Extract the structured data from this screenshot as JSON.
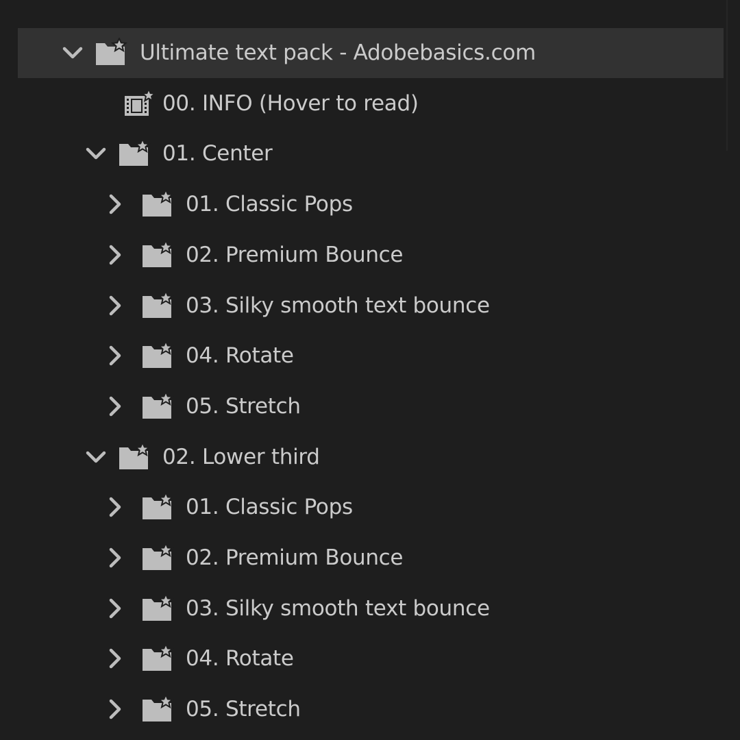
{
  "tree": [
    {
      "id": "root",
      "label": "Ultimate text pack - Adobebasics.com",
      "type": "bin",
      "depth": 0,
      "expanded": true,
      "selected": true
    },
    {
      "id": "info",
      "label": "00. INFO (Hover to read)",
      "type": "sequence",
      "depth": 1
    },
    {
      "id": "center",
      "label": "01. Center",
      "type": "bin",
      "depth": 1,
      "expanded": true
    },
    {
      "id": "center-classic-pops",
      "label": "01. Classic Pops",
      "type": "bin",
      "depth": 2,
      "expanded": false
    },
    {
      "id": "center-premium-bounce",
      "label": "02. Premium Bounce",
      "type": "bin",
      "depth": 2,
      "expanded": false
    },
    {
      "id": "center-silky-smooth",
      "label": "03. Silky smooth text bounce",
      "type": "bin",
      "depth": 2,
      "expanded": false
    },
    {
      "id": "center-rotate",
      "label": "04. Rotate",
      "type": "bin",
      "depth": 2,
      "expanded": false
    },
    {
      "id": "center-stretch",
      "label": "05. Stretch",
      "type": "bin",
      "depth": 2,
      "expanded": false
    },
    {
      "id": "lower-third",
      "label": "02. Lower third",
      "type": "bin",
      "depth": 1,
      "expanded": true
    },
    {
      "id": "lower-classic-pops",
      "label": "01. Classic Pops",
      "type": "bin",
      "depth": 2,
      "expanded": false
    },
    {
      "id": "lower-premium-bounce",
      "label": "02. Premium Bounce",
      "type": "bin",
      "depth": 2,
      "expanded": false
    },
    {
      "id": "lower-silky-smooth",
      "label": "03. Silky smooth text bounce",
      "type": "bin",
      "depth": 2,
      "expanded": false
    },
    {
      "id": "lower-rotate",
      "label": "04. Rotate",
      "type": "bin",
      "depth": 2,
      "expanded": false
    },
    {
      "id": "lower-stretch",
      "label": "05. Stretch",
      "type": "bin",
      "depth": 2,
      "expanded": false
    }
  ],
  "icons": {
    "bin": "bin-folder-star-icon",
    "sequence": "sequence-film-star-icon",
    "expanded": "chevron-down-icon",
    "collapsed": "chevron-right-icon"
  },
  "colors": {
    "background": "#1e1e1e",
    "selected_row": "#323232",
    "icon": "#bdbdbd",
    "text": "#cbcbcb"
  }
}
